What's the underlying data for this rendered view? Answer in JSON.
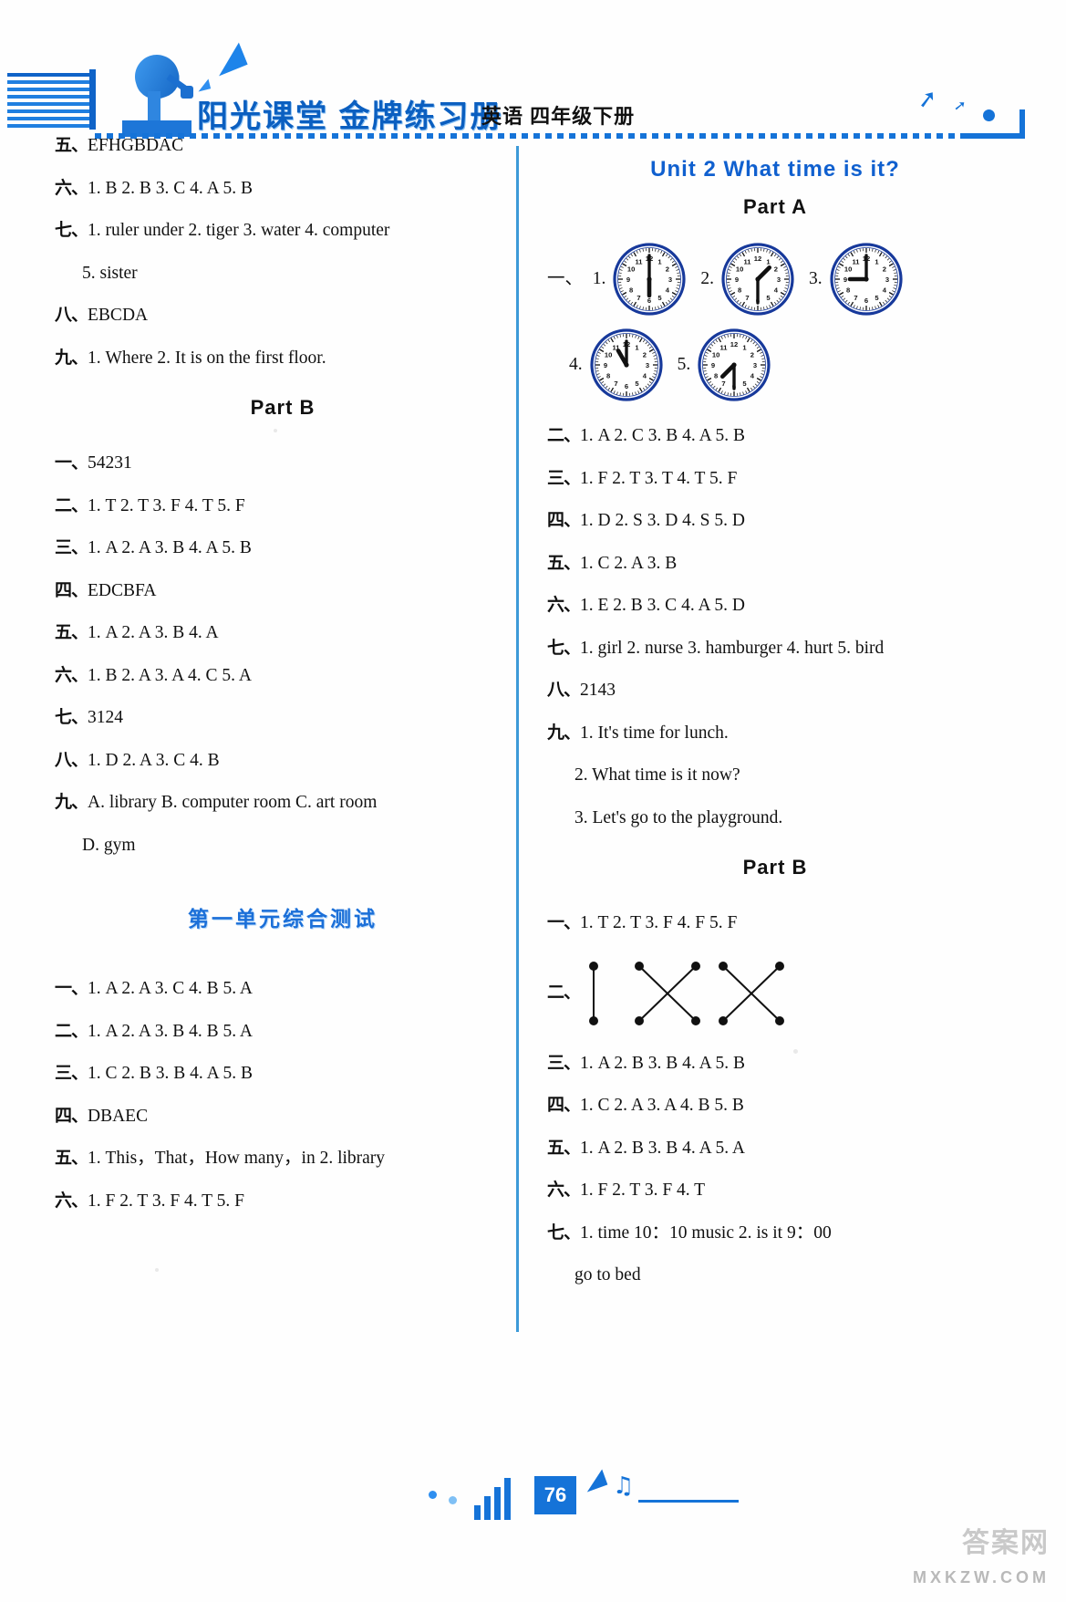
{
  "header": {
    "brand": "阳光课堂  金牌练习册",
    "subject": "英语  四年级下册"
  },
  "left_column": {
    "part_a_tail": [
      {
        "num": "五、",
        "answers": "EFHGBDAC"
      },
      {
        "num": "六、",
        "answers": "1. B   2. B   3. C   4. A   5. B"
      },
      {
        "num": "七、",
        "answers": "1. ruler   under   2. tiger   3. water   4. computer"
      },
      {
        "num": "",
        "answers": "5. sister",
        "indent": true
      },
      {
        "num": "八、",
        "answers": "EBCDA"
      },
      {
        "num": "九、",
        "answers": "1. Where   2. It is on the first floor."
      }
    ],
    "part_b_heading": "Part B",
    "part_b": [
      {
        "num": "一、",
        "answers": "54231"
      },
      {
        "num": "二、",
        "answers": "1. T   2. T   3. F   4. T   5. F"
      },
      {
        "num": "三、",
        "answers": "1. A   2. A   3. B   4. A   5. B"
      },
      {
        "num": "四、",
        "answers": "EDCBFA"
      },
      {
        "num": "五、",
        "answers": "1. A   2. A   3. B   4. A"
      },
      {
        "num": "六、",
        "answers": "1. B   2. A   3. A   4. C   5. A"
      },
      {
        "num": "七、",
        "answers": "3124"
      },
      {
        "num": "八、",
        "answers": "1. D   2. A   3. C   4. B"
      },
      {
        "num": "九、",
        "answers": "A. library   B. computer room   C. art room"
      },
      {
        "num": "",
        "answers": "D. gym",
        "indent": true
      }
    ],
    "unit_test_heading": "第一单元综合测试",
    "unit_test": [
      {
        "num": "一、",
        "answers": "1. A   2. A   3. C   4. B   5. A"
      },
      {
        "num": "二、",
        "answers": "1. A   2. A   3. B   4. B   5. A"
      },
      {
        "num": "三、",
        "answers": "1. C   2. B   3. B   4. A   5. B"
      },
      {
        "num": "四、",
        "answers": "DBAEC"
      },
      {
        "num": "五、",
        "answers": "1. This，That，How many，in   2. library"
      },
      {
        "num": "六、",
        "answers": "1. F   2. T   3. F   4. T   5. F"
      }
    ]
  },
  "right_column": {
    "unit_heading": "Unit 2   What time is it?",
    "part_a_heading": "Part A",
    "clock_question_label": "一、",
    "clocks_row1": [
      {
        "label": "1.",
        "hour": 6,
        "minute": 0,
        "time": "6:00"
      },
      {
        "label": "2.",
        "hour": 1,
        "minute": 30,
        "time": "1:30"
      },
      {
        "label": "3.",
        "hour": 9,
        "minute": 0,
        "time": "9:00"
      }
    ],
    "clocks_row2": [
      {
        "label": "4.",
        "hour": 11,
        "minute": 0,
        "time": "11:00"
      },
      {
        "label": "5.",
        "hour": 7,
        "minute": 30,
        "time": "7:30"
      }
    ],
    "part_a": [
      {
        "num": "二、",
        "answers": "1. A   2. C   3. B   4. A   5. B"
      },
      {
        "num": "三、",
        "answers": "1. F   2. T   3. T   4. T   5. F"
      },
      {
        "num": "四、",
        "answers": "1. D   2. S   3. D   4. S   5. D"
      },
      {
        "num": "五、",
        "answers": "1. C   2. A   3. B"
      },
      {
        "num": "六、",
        "answers": "1. E   2. B   3. C   4. A   5. D"
      },
      {
        "num": "七、",
        "answers": "1. girl   2. nurse   3. hamburger   4. hurt   5. bird"
      },
      {
        "num": "八、",
        "answers": "2143"
      },
      {
        "num": "九、",
        "answers": "1. It's time for lunch."
      },
      {
        "num": "",
        "answers": "2. What time is it now?",
        "indent": true
      },
      {
        "num": "",
        "answers": "3. Let's go to the playground.",
        "indent": true
      }
    ],
    "part_b_heading": "Part B",
    "part_b_first": {
      "num": "一、",
      "answers": "1. T   2. T   3. F   4. F   5. F"
    },
    "match_label": "二、",
    "part_b": [
      {
        "num": "三、",
        "answers": "1. A   2. B   3. B   4. A   5. B"
      },
      {
        "num": "四、",
        "answers": "1. C   2. A   3. A   4. B   5. B"
      },
      {
        "num": "五、",
        "answers": "1. A   2. B   3. B   4. A   5. A"
      },
      {
        "num": "六、",
        "answers": "1. F   2. T   3. F   4. T"
      },
      {
        "num": "七、",
        "answers": "1. time   10：10   music   2. is it   9：00"
      },
      {
        "num": "",
        "answers": "go to bed",
        "indent": true
      }
    ]
  },
  "footer": {
    "page_number": "76",
    "watermark": "答案网",
    "watermark_sub": "MXKZW.COM"
  },
  "colors": {
    "accent_blue": "#1573d8",
    "heading_blue": "#1060cf",
    "divider_blue": "#3d9ad8",
    "clock_rim": "#17399b"
  }
}
